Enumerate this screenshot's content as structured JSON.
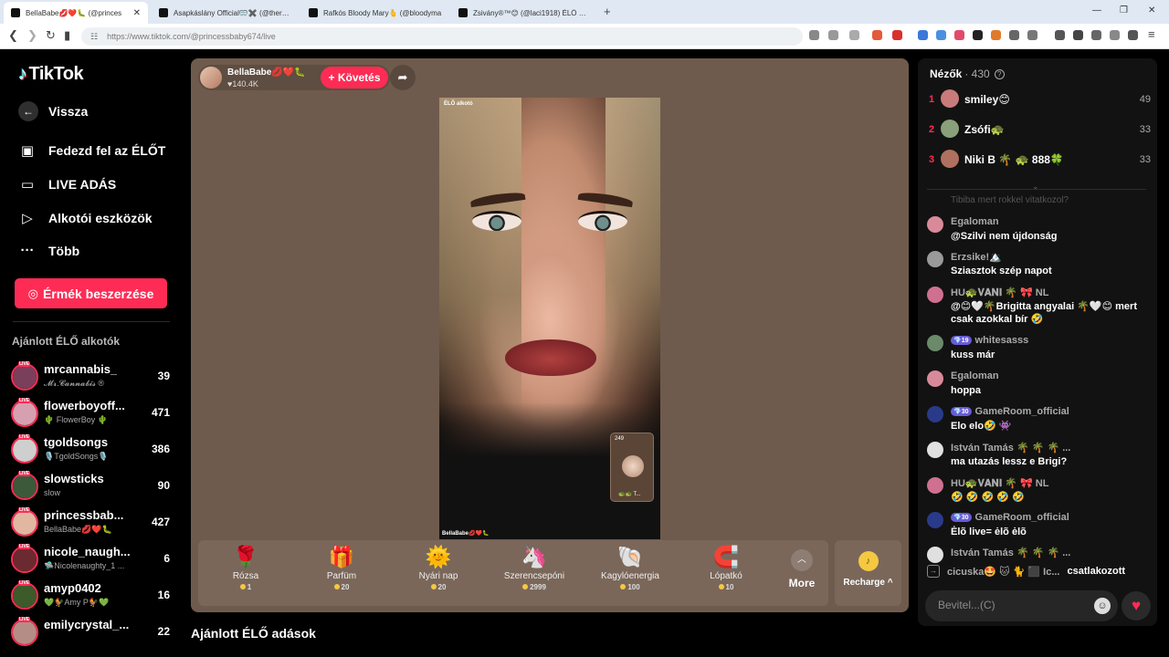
{
  "browser": {
    "tabs": [
      {
        "title": "BellaBabe💋❤️🐛 (@princes",
        "active": true
      },
      {
        "title": "Asapkáslány Official🥽✖️ (@theresa",
        "active": false
      },
      {
        "title": "Rafkós Bloody Mary🫰 (@bloodyma",
        "active": false
      },
      {
        "title": "Zsivány®™😊 (@laci1918) ÉLŐ adás",
        "active": false
      }
    ],
    "new_tab": "+",
    "url": "https://www.tiktok.com/@princessbaby674/live"
  },
  "sidebar": {
    "logo": "TikTok",
    "nav": [
      {
        "label": "Vissza",
        "icon": "arrow-left-icon"
      },
      {
        "label": "Fedezd fel az ÉLŐT",
        "icon": "calendar-live-icon"
      },
      {
        "label": "LIVE ADÁS",
        "icon": "video-camera-icon"
      },
      {
        "label": "Alkotói eszközök",
        "icon": "creator-tools-icon"
      },
      {
        "label": "Több",
        "icon": "more-dots-icon"
      }
    ],
    "coins_button": "Érmék beszerzése",
    "recommended_title": "Ajánlott ÉLŐ alkotók",
    "live_badge": "LIVE",
    "creators": [
      {
        "name": "mrcannabis_",
        "sub": "𝓜𝓻.𝓒𝓪𝓷𝓷𝓪𝓫𝓲𝓼 ®",
        "count": "39",
        "color": "#7a3f5a"
      },
      {
        "name": "flowerboyoff...",
        "sub": "🌵 FlowerBoy 🌵",
        "count": "471",
        "color": "#d7a0b0"
      },
      {
        "name": "tgoldsongs",
        "sub": "🎙️TgoldSongs🎙️",
        "count": "386",
        "color": "#cfcfcf"
      },
      {
        "name": "slowsticks",
        "sub": "slow",
        "count": "90",
        "color": "#3a5a3a"
      },
      {
        "name": "princessbab...",
        "sub": "BellaBabe💋❤️🐛",
        "count": "427",
        "color": "#e2b7a2"
      },
      {
        "name": "nicole_naugh...",
        "sub": "🛸Nicolenaughty_1 ...",
        "count": "6",
        "color": "#6b2a30"
      },
      {
        "name": "amyp0402",
        "sub": "💚🐓Amy P🐓💚",
        "count": "16",
        "color": "#3d5a2a"
      },
      {
        "name": "emilycrystal_...",
        "sub": "",
        "count": "22",
        "color": "#b48e86"
      }
    ]
  },
  "stage": {
    "host_name": "BellaBabe💋❤️🐛",
    "host_likes": "♥140.4K",
    "follow_button": "+ Követés",
    "video_tag": "ÉLŐ alkotó",
    "video_footer": "BellaBabe💋❤️🐛",
    "pip_count": "249",
    "pip_label": "🐢🐢 T...",
    "gifts": [
      {
        "name": "Rózsa",
        "price": "1",
        "icon": "🌹"
      },
      {
        "name": "Parfüm",
        "price": "20",
        "icon": "🎁"
      },
      {
        "name": "Nyári nap",
        "price": "20",
        "icon": "🌞"
      },
      {
        "name": "Szerencsepóni",
        "price": "2999",
        "icon": "🦄"
      },
      {
        "name": "Kagylóenergia",
        "price": "100",
        "icon": "🐚"
      },
      {
        "name": "Lópatkó",
        "price": "10",
        "icon": "🧲"
      }
    ],
    "more_label": "More",
    "recharge_label": "Recharge ^"
  },
  "recommended_live_title": "Ajánlott ÉLŐ adások",
  "chat": {
    "viewers_title": "Nézők",
    "viewers_count": "· 430",
    "top_viewers": [
      {
        "rank": "1",
        "name": "smiley😊",
        "score": "49",
        "color": "#c97a7a"
      },
      {
        "rank": "2",
        "name": "Zsófi🐢",
        "score": "33",
        "color": "#8aa07a"
      },
      {
        "rank": "3",
        "name": "Niki B 🌴 🐢 888🍀",
        "score": "33",
        "color": "#b07060"
      }
    ],
    "faded_message": "Tibiba mert rokkel vitatkozol?",
    "messages": [
      {
        "user": "Egaloman",
        "badge": "",
        "text": "@Szilvi nem újdonság",
        "color": "#d88a9a"
      },
      {
        "user": "Erzsike!🏔️",
        "badge": "",
        "text": "Sziasztok szép napot",
        "color": "#9a9a9a"
      },
      {
        "user": "HU🐢𝐕𝐀𝐍𝐈 🌴 🎀 NL",
        "badge": "",
        "text": "@😊🤍🌴Brigitta angyalai 🌴🤍😊 mert csak azokkal bír 🤣",
        "color": "#d07090"
      },
      {
        "user": "whitesasss",
        "badge": "💎19",
        "text": "kuss már",
        "color": "#6a8a6a"
      },
      {
        "user": "Egaloman",
        "badge": "",
        "text": "hoppa",
        "color": "#d88a9a"
      },
      {
        "user": "GameRoom_official",
        "badge": "💎30",
        "text": "Elo elo🤣 👾",
        "color": "#2a3a8a"
      },
      {
        "user": "István Tamás 🌴 🌴 🌴 ...",
        "badge": "",
        "text": "ma utazás lessz e Brigi?",
        "color": "#e0e0e0"
      },
      {
        "user": "HU🐢𝐕𝐀𝐍𝐈 🌴 🎀 NL",
        "badge": "",
        "text": "🤣 🤣 🤣 🤣 🤣",
        "color": "#d07090"
      },
      {
        "user": "GameRoom_official",
        "badge": "💎30",
        "text": "Ėlõ live= ėlõ ėlõ",
        "color": "#2a3a8a"
      },
      {
        "user": "István Tamás 🌴 🌴 🌴 ...",
        "badge": "",
        "text": "",
        "color": "#e0e0e0"
      }
    ],
    "join_user": "cicuska🤩 🐱 🐈 ⬛ Ic...",
    "join_text": "csatlakozott",
    "input_placeholder": "Bevitel...(C)"
  },
  "colors": {
    "accent": "#fe2c55",
    "stage_bg": "#6f5b4d",
    "chat_bg": "#121212"
  }
}
